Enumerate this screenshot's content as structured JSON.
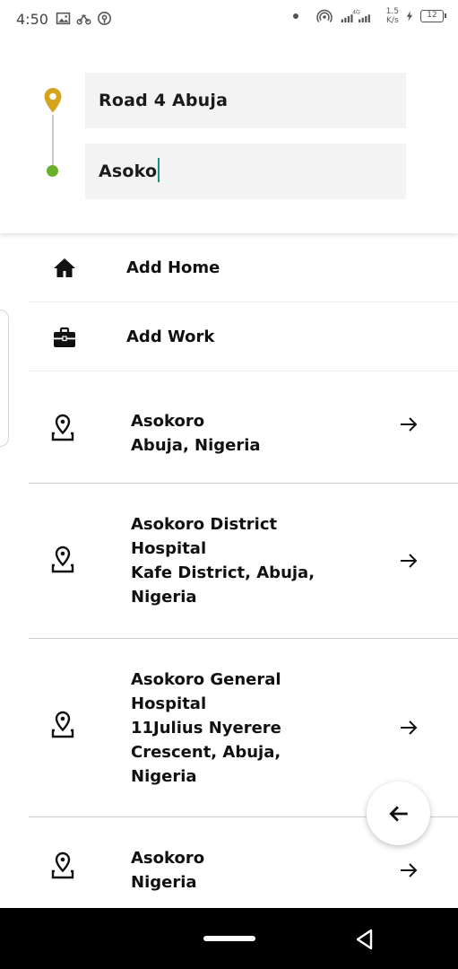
{
  "status_bar": {
    "time": "4:50",
    "network": "4G",
    "speed_value": "1.5",
    "speed_unit": "K/s",
    "battery": "12"
  },
  "route": {
    "origin_value": "Road 4 Abuja",
    "destination_value": "Asoko",
    "origin_pin_color": "#d4a51c",
    "destination_dot_color": "#6bb02a"
  },
  "quick_actions": [
    {
      "label": "Add Home",
      "icon": "home-icon"
    },
    {
      "label": "Add Work",
      "icon": "briefcase-icon"
    }
  ],
  "results": [
    {
      "lines": [
        "Asokoro",
        "Abuja, Nigeria"
      ]
    },
    {
      "lines": [
        "Asokoro District",
        "Hospital",
        "Kafe District, Abuja,",
        "Nigeria"
      ]
    },
    {
      "lines": [
        "Asokoro General",
        "Hospital",
        "11Julius Nyerere",
        "Crescent, Abuja,",
        "Nigeria"
      ]
    },
    {
      "lines": [
        "Asokoro",
        "Nigeria"
      ]
    }
  ]
}
